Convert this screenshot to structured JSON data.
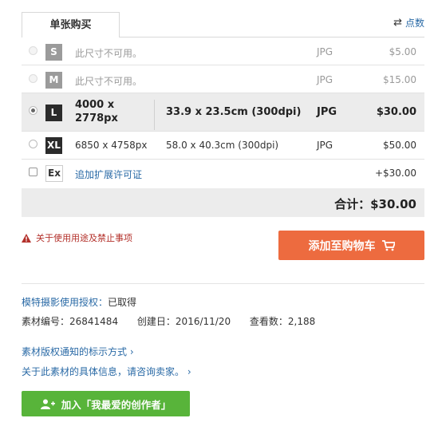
{
  "tabs": {
    "single_purchase": "单张购买"
  },
  "points_link": "点数",
  "sizes": [
    {
      "code": "S",
      "desc": "此尺寸不可用。",
      "format": "JPG",
      "price": "$5.00"
    },
    {
      "code": "M",
      "desc": "此尺寸不可用。",
      "format": "JPG",
      "price": "$15.00"
    },
    {
      "code": "L",
      "pixels_line1": "4000 x",
      "pixels_line2": "2778px",
      "cm": "33.9 x 23.5cm (300dpi)",
      "format": "JPG",
      "price": "$30.00"
    },
    {
      "code": "XL",
      "pixels": "6850 x 4758px",
      "cm": "58.0 x 40.3cm (300dpi)",
      "format": "JPG",
      "price": "$50.00"
    },
    {
      "code": "Ex",
      "desc": "追加扩展许可证",
      "price": "+$30.00"
    }
  ],
  "total": "合计：$30.00",
  "warning": "关于使用用途及禁止事项",
  "add_to_cart": "添加至购物车",
  "model_release": {
    "label": "模特摄影使用授权：",
    "value": "已取得"
  },
  "meta": {
    "material_no": "素材编号：26841484",
    "created": "创建日：2016/11/20",
    "views": "查看数：2,188"
  },
  "links": {
    "copyright_notice": "素材版权通知的标示方式 ›",
    "contact_seller": "关于此素材的具体信息，请咨询卖家。 ›"
  },
  "favorite_button": "加入「我最爱的创作者」",
  "colors": {
    "accent_orange": "#ed6b3f",
    "accent_green": "#58b43a",
    "link_blue": "#2a6aa6",
    "warning_red": "#b3302a"
  }
}
